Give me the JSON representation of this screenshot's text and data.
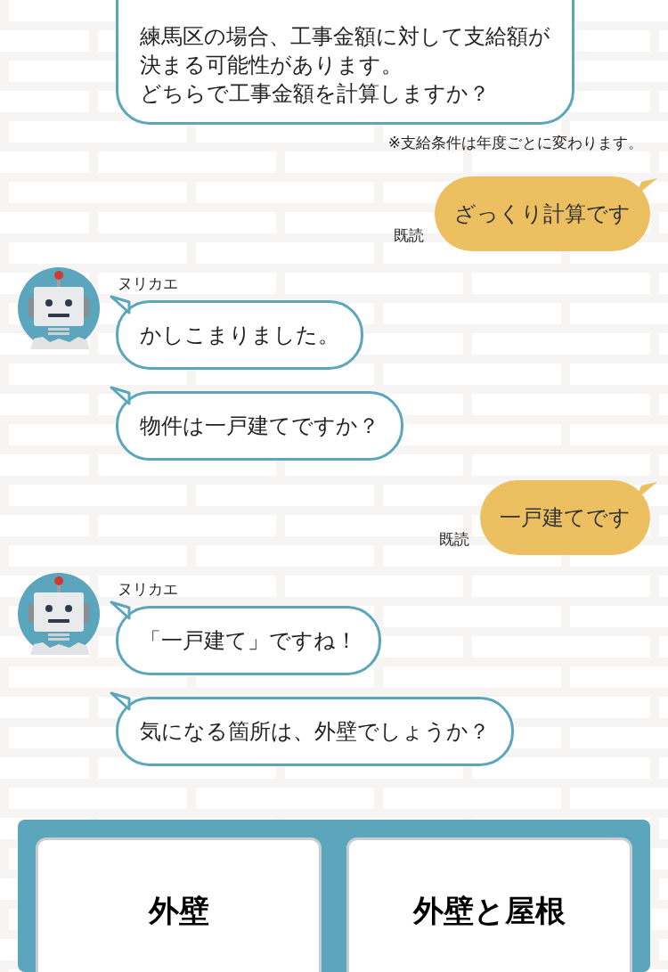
{
  "messages": [
    {
      "kind": "bot",
      "lines": [
        "練馬区の場合、工事金額に対して支給額が",
        "決まる可能性があります。",
        "どちらで工事金額を計算しますか？"
      ]
    },
    {
      "kind": "note",
      "text": "※支給条件は年度ごとに変わります。"
    },
    {
      "kind": "user",
      "text": "ざっくり計算です",
      "read": "既読"
    },
    {
      "kind": "bot",
      "sender": "ヌリカエ",
      "text": "かしこまりました。"
    },
    {
      "kind": "bot",
      "text": "物件は一戸建てですか？"
    },
    {
      "kind": "user",
      "text": "一戸建てです",
      "read": "既読"
    },
    {
      "kind": "bot",
      "sender": "ヌリカエ",
      "text": "「一戸建て」ですね！"
    },
    {
      "kind": "bot",
      "text": "気になる箇所は、外壁でしょうか？"
    }
  ],
  "options": [
    "外壁",
    "外壁と屋根"
  ]
}
